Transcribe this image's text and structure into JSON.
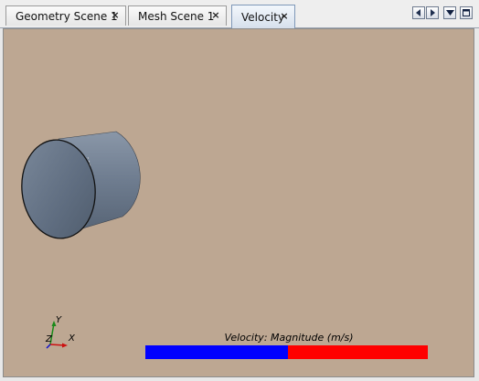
{
  "tabs": [
    {
      "label": "Geometry Scene 1",
      "close": "×",
      "active": false
    },
    {
      "label": "Mesh Scene 1",
      "close": "×",
      "active": false
    },
    {
      "label": "Velocity",
      "close": "×",
      "active": true
    }
  ],
  "tab_nav": {
    "icons": [
      "scroll-left-icon",
      "scroll-right-icon",
      "tab-list-dropdown-icon",
      "maximize-icon"
    ]
  },
  "scene": {
    "background_color": "#bda792",
    "object": "cylinder",
    "object_color": "#6e7d8f"
  },
  "axes_triad": {
    "y_label": "Y",
    "x_label": "X",
    "z_label": "Z"
  },
  "legend": {
    "title": "Velocity: Magnitude (m/s)",
    "colors": [
      "#0000ff",
      "#ff0000"
    ]
  }
}
